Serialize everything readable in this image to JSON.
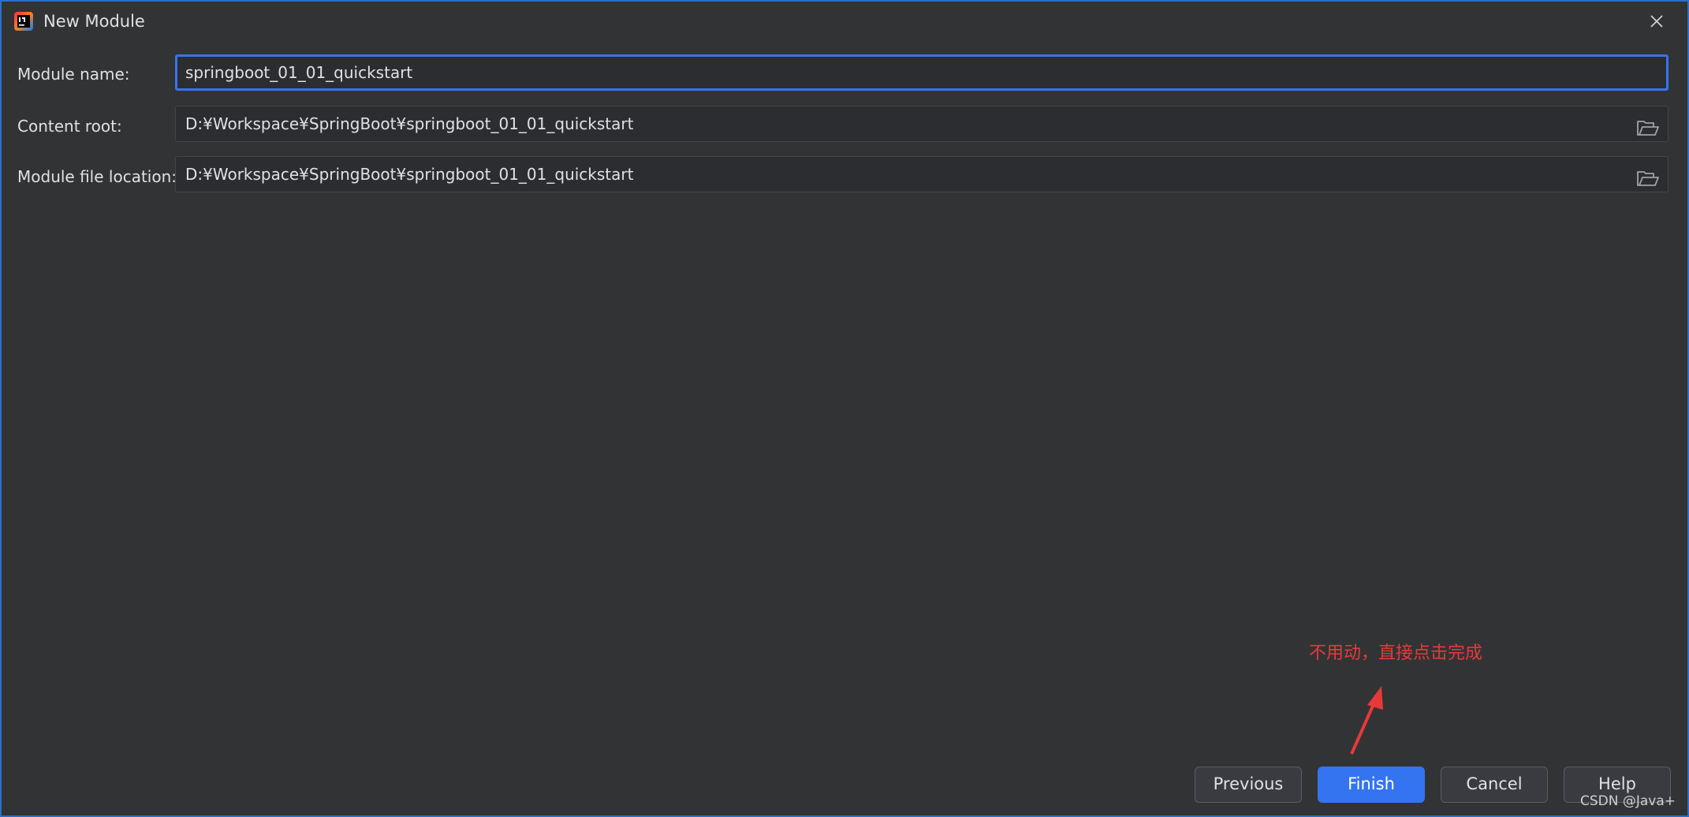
{
  "window": {
    "title": "New Module",
    "app_icon": "intellij-idea-icon",
    "close_icon": "close-icon"
  },
  "form": {
    "module_name": {
      "label": "Module name:",
      "value": "springboot_01_01_quickstart"
    },
    "content_root": {
      "label": "Content root:",
      "value": "D:¥Workspace¥SpringBoot¥springboot_01_01_quickstart",
      "browse_icon": "folder-icon"
    },
    "module_file_location": {
      "label": "Module file location:",
      "value": "D:¥Workspace¥SpringBoot¥springboot_01_01_quickstart",
      "browse_icon": "folder-icon"
    }
  },
  "annotation": {
    "text": "不用动，直接点击完成",
    "color": "#e8393a"
  },
  "buttons": {
    "previous": "Previous",
    "finish": "Finish",
    "cancel": "Cancel",
    "help": "Help"
  },
  "watermark": "CSDN @Java+",
  "colors": {
    "accent": "#3574f0",
    "background": "#323334",
    "window_border": "#2b6fc9"
  }
}
